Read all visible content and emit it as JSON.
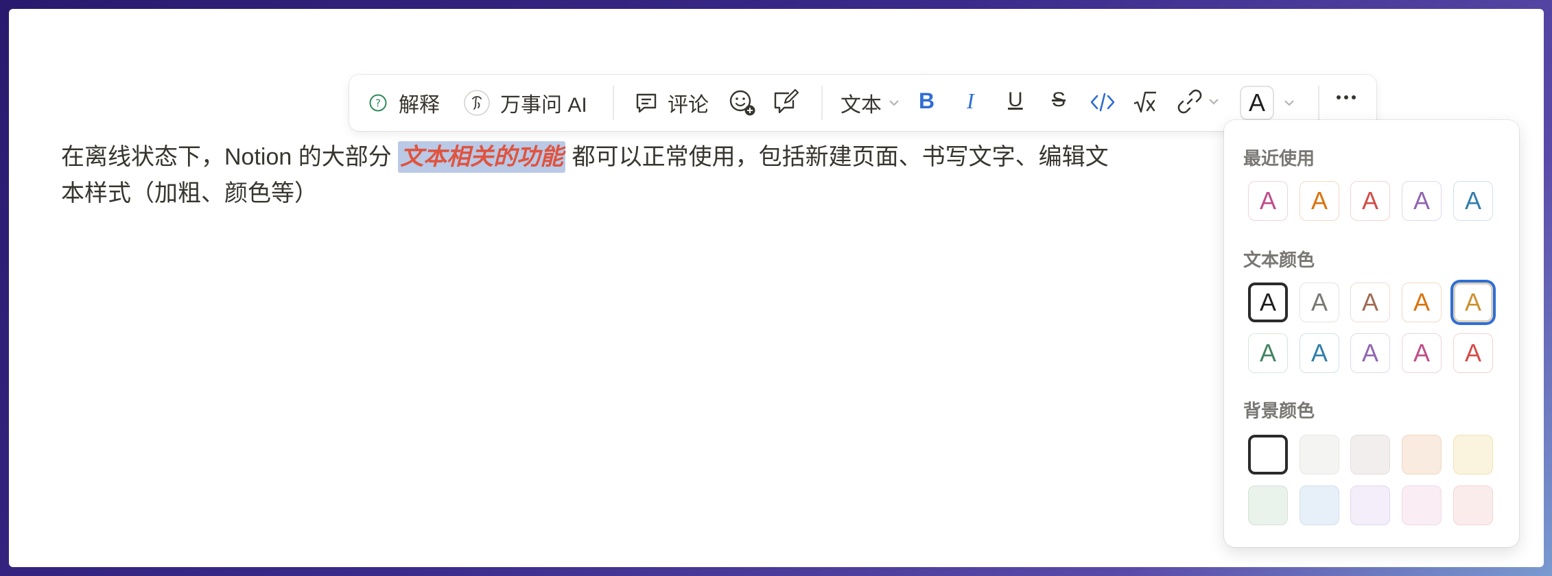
{
  "toolbar": {
    "explain_label": "解释",
    "ask_ai_label": "万事问 AI",
    "comment_label": "评论",
    "text_type_label": "文本",
    "font_color_glyph": "A"
  },
  "document": {
    "line1_before": "在离线状态下，Notion 的大部分 ",
    "selected_text": "文本相关的功能",
    "line1_after": " 都可以正常使用，包括新建页面、书写文字、编辑文",
    "line2": "本样式（加粗、颜色等）"
  },
  "color_menu": {
    "recent_title": "最近使用",
    "text_color_title": "文本颜色",
    "background_title": "背景颜色",
    "glyph": "A",
    "recent": [
      {
        "color": "#c14c8a",
        "bg": "#ffffff",
        "border": "#ecd3e0"
      },
      {
        "color": "#d9730d",
        "bg": "#ffffff",
        "border": "#f0d9c4"
      },
      {
        "color": "#d44c47",
        "bg": "#ffffff",
        "border": "#f0d3d1"
      },
      {
        "color": "#9065b0",
        "bg": "#ffffff",
        "border": "#e2d6ec"
      },
      {
        "color": "#337ea9",
        "bg": "#ffffff",
        "border": "#cfe0ec"
      }
    ],
    "text_colors": [
      {
        "name": "default",
        "color": "#1f1f1f",
        "bg": "#ffffff",
        "border": "#2b2b2b",
        "selected": "dark"
      },
      {
        "name": "gray",
        "color": "#787774",
        "bg": "#ffffff",
        "border": "#e3e3e0"
      },
      {
        "name": "brown",
        "color": "#9f6b53",
        "bg": "#ffffff",
        "border": "#ebdcd5"
      },
      {
        "name": "orange",
        "color": "#d9730d",
        "bg": "#ffffff",
        "border": "#f0d9c4"
      },
      {
        "name": "yellow",
        "color": "#cb912f",
        "bg": "#ffffff",
        "border": "#d9d2c2",
        "selected": "blue"
      },
      {
        "name": "green",
        "color": "#448361",
        "bg": "#ffffff",
        "border": "#d3e6da"
      },
      {
        "name": "blue",
        "color": "#337ea9",
        "bg": "#ffffff",
        "border": "#cfe0ec"
      },
      {
        "name": "purple",
        "color": "#9065b0",
        "bg": "#ffffff",
        "border": "#e2d6ec"
      },
      {
        "name": "pink",
        "color": "#c14c8a",
        "bg": "#ffffff",
        "border": "#ecd3e0"
      },
      {
        "name": "red",
        "color": "#d44c47",
        "bg": "#ffffff",
        "border": "#f0d3d1"
      }
    ],
    "background_colors": [
      {
        "name": "default",
        "bg": "#ffffff",
        "border": "#2b2b2b",
        "selected": "dark"
      },
      {
        "name": "gray",
        "bg": "#f4f4f3",
        "border": "#e6e6e3"
      },
      {
        "name": "brown",
        "bg": "#f3eeee",
        "border": "#e6dcdc"
      },
      {
        "name": "orange",
        "bg": "#f9ebdf",
        "border": "#f0d8c3"
      },
      {
        "name": "yellow",
        "bg": "#faf3dd",
        "border": "#f0e2b6"
      },
      {
        "name": "green",
        "bg": "#eaf2ec",
        "border": "#d3e3d7"
      },
      {
        "name": "blue",
        "bg": "#e7f0f8",
        "border": "#cfdfec"
      },
      {
        "name": "purple",
        "bg": "#f3eef9",
        "border": "#e2d6ee"
      },
      {
        "name": "pink",
        "bg": "#faeef4",
        "border": "#f0d8e4"
      },
      {
        "name": "red",
        "bg": "#fbecec",
        "border": "#f1d3d3"
      }
    ]
  }
}
